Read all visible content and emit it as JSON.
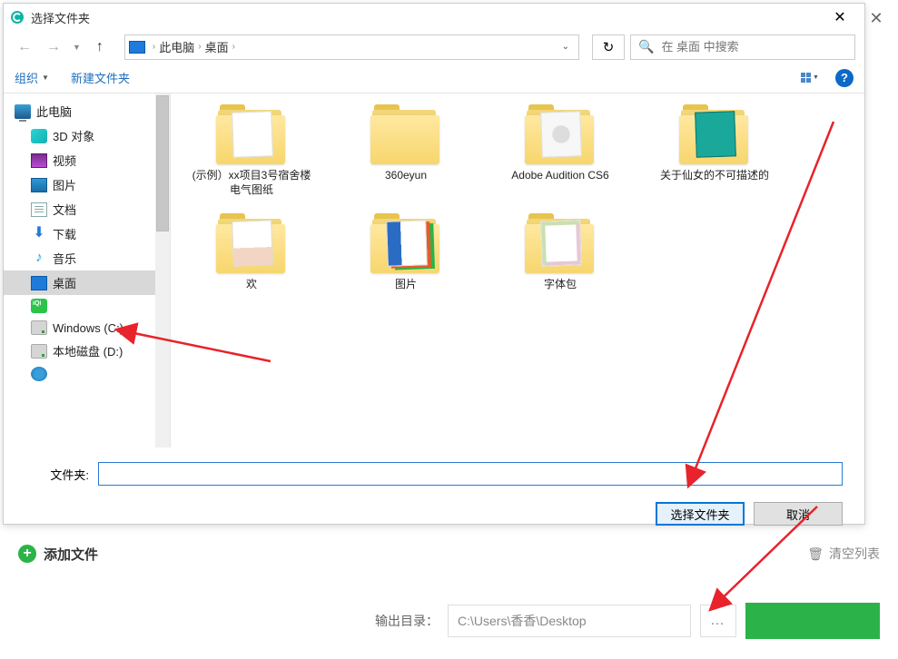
{
  "dialog": {
    "title": "选择文件夹",
    "breadcrumb": {
      "root": "此电脑",
      "current": "桌面"
    },
    "search_placeholder": "在 桌面 中搜索",
    "toolbar": {
      "organize": "组织",
      "new_folder": "新建文件夹"
    },
    "sidebar": {
      "items": [
        {
          "label": "此电脑",
          "icon": "pc",
          "root": true
        },
        {
          "label": "3D 对象",
          "icon": "3d"
        },
        {
          "label": "视频",
          "icon": "video"
        },
        {
          "label": "图片",
          "icon": "pictures"
        },
        {
          "label": "文档",
          "icon": "docs"
        },
        {
          "label": "下载",
          "icon": "downloads"
        },
        {
          "label": "音乐",
          "icon": "music"
        },
        {
          "label": "桌面",
          "icon": "desktop",
          "selected": true
        },
        {
          "label": "",
          "icon": "iqiyi"
        },
        {
          "label": "Windows (C:)",
          "icon": "drive"
        },
        {
          "label": "本地磁盘 (D:)",
          "icon": "drive"
        },
        {
          "label": "",
          "icon": "net"
        }
      ]
    },
    "folders": [
      {
        "label": "(示例）xx项目3号宿舍楼电气图纸"
      },
      {
        "label": "360eyun"
      },
      {
        "label": "Adobe Audition CS6"
      },
      {
        "label": "关于仙女的不可描述的"
      },
      {
        "label": "欢"
      },
      {
        "label": "图片"
      },
      {
        "label": "字体包"
      }
    ],
    "folder_field_label": "文件夹:",
    "folder_field_value": "",
    "buttons": {
      "select": "选择文件夹",
      "cancel": "取消"
    }
  },
  "lower": {
    "add_file": "添加文件",
    "clear_list": "清空列表"
  },
  "output": {
    "label": "输出目录：",
    "path": "C:\\Users\\香香\\Desktop"
  }
}
